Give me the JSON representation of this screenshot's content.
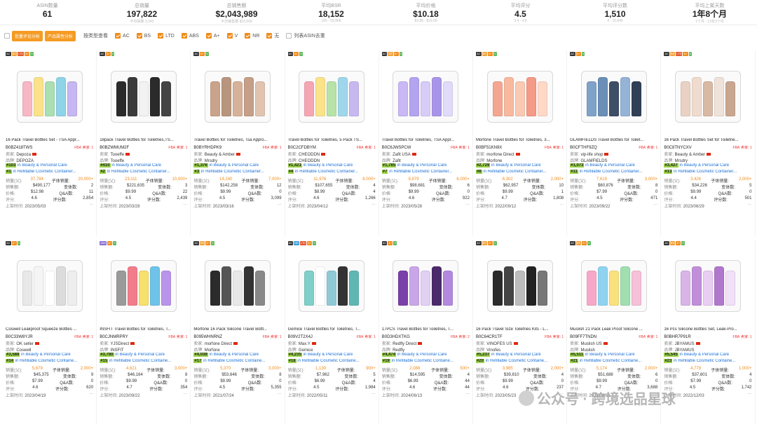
{
  "stats": [
    {
      "label": "ASIN数量",
      "value": "61",
      "sub": ""
    },
    {
      "label": "总销量",
      "value": "197,822",
      "sub": "平均销量 3,243"
    },
    {
      "label": "总销售额",
      "value": "$2,043,989",
      "sub": "平均销售额 $33,508"
    },
    {
      "label": "平均BSR",
      "value": "18,152",
      "sub": "105 - 59,868"
    },
    {
      "label": "平均价格",
      "value": "$10.18",
      "sub": "$3.88 - $19.99"
    },
    {
      "label": "平均评分",
      "value": "4.5",
      "sub": "3.4 - 4.8"
    },
    {
      "label": "平均评分数",
      "value": "1,510",
      "sub": "4 - 15,846"
    },
    {
      "label": "平均上架天数",
      "value": "1年8个月",
      "sub": "1个月 - 13年3个月"
    }
  ],
  "filters": {
    "btn1": "批量评论分析",
    "btn2": "产品属性分析",
    "group": "按类型查看",
    "opts": [
      "AC",
      "BS",
      "LTD",
      "ABS",
      "A+",
      "V",
      "NR",
      "无"
    ],
    "last": "列表ASIN去重"
  },
  "labels": {
    "seller": "卖家:",
    "brand": "品牌:",
    "sales": "销量(父):",
    "subsales": "子体销量:",
    "revenue": "销售额:",
    "variants": "变体数:",
    "price": "价格:",
    "qa": "Q&A数:",
    "rating": "评分:",
    "reviews": "评分数:",
    "date": "上架时间:",
    "fba": "FBA",
    "sellers": "卖家: ",
    "in": "in"
  },
  "cards": [
    {
      "badges": [
        "AC",
        "BS",
        "LTD",
        "A+",
        "V"
      ],
      "title": "16 Pack Travel Bottles Set - TSA Appr...",
      "asin": "B0BZ418TWS",
      "sellers": "1",
      "seller": "Depoza",
      "brand": "DEPOZA",
      "r1": "#103",
      "c1": "Beauty & Personal Care",
      "r2": "#1",
      "c2": "Refillable Cosmetic Container...",
      "sales": "37,784",
      "subsales": "20,000+",
      "revenue": "$490,177",
      "variants": "2",
      "price": "$12.98",
      "qa": "11",
      "rating": "4.6",
      "reviews": "2,854",
      "date": "2023/05/03"
    },
    {
      "badges": [
        "AC",
        "A+",
        "V"
      ],
      "title": "18pack Travel Bottles for Toiletries,TS...",
      "asin": "B0BZWMUM2F",
      "sellers": "1",
      "seller": "Tooeffe",
      "brand": "Tooeffe",
      "r1": "#410",
      "c1": "Beauty & Personal Care",
      "r2": "#2",
      "c2": "Refillable Cosmetic Container...",
      "sales": "23,111",
      "subsales": "10,000+",
      "revenue": "$221,635",
      "variants": "3",
      "price": "$9.99",
      "qa": "22",
      "rating": "4.5",
      "reviews": "2,439",
      "date": "2023/03/28"
    },
    {
      "badges": [
        "AC",
        "A+",
        "V"
      ],
      "title": "Travel Bottles for Toiletries, Tsa Appro...",
      "asin": "B0BYRHDPK9",
      "sellers": "1",
      "seller": "Beauty & Amber",
      "brand": "Mrsdry",
      "r1": "#1,376",
      "c1": "Beauty & Personal Care",
      "r2": "#3",
      "c2": "Refillable Cosmetic Container...",
      "sales": "14,240",
      "subsales": "7,000+",
      "revenue": "$142,258",
      "variants": "12",
      "price": "$9.99",
      "qa": "0",
      "rating": "4.5",
      "reviews": "3,099",
      "date": "2023/03/16"
    },
    {
      "badges": [
        "AC",
        "A+",
        "V"
      ],
      "title": "Travel Bottles for Toiletries, 5 Pack TS...",
      "asin": "B0C2CFDBYM",
      "sellers": "1",
      "seller": "CHEODDN",
      "brand": "CHEODDN",
      "r1": "#1,421",
      "c1": "Beauty & Personal Care",
      "r2": "#4",
      "c2": "Refillable Cosmetic Container...",
      "sales": "11,976",
      "subsales": "8,000+",
      "revenue": "$107,655",
      "variants": "4",
      "price": "$8.99",
      "qa": "4",
      "rating": "4.6",
      "reviews": "1,266",
      "date": "2023/04/12"
    },
    {
      "badges": [
        "AC",
        "BS",
        "A+",
        "V"
      ],
      "title": "Travel Bottles for Toiletries, TSA Appr...",
      "asin": "B0C6JWSPCW",
      "sellers": "1",
      "seller": "Zafit USA",
      "brand": "Zafit",
      "r1": "#1,785",
      "c1": "Beauty & Personal Care",
      "r2": "#7",
      "c2": "Refillable Cosmetic Container...",
      "sales": "9,879",
      "subsales": "6,000+",
      "revenue": "$98,681",
      "variants": "6",
      "price": "$9.99",
      "qa": "0",
      "rating": "4.6",
      "reviews": "922",
      "date": "2023/05/28"
    },
    {
      "badges": [
        "AC",
        "BS",
        "A+",
        "V"
      ],
      "title": "Morfone Travel Bottles for Toiletries, 3...",
      "asin": "B0BF51KN9X",
      "sellers": "1",
      "seller": "morfone Direct",
      "brand": "Morfone",
      "r1": "#2,729",
      "c1": "Beauty & Personal Care",
      "r2": "#8",
      "c2": "Refillable Cosmetic Container...",
      "sales": "6,302",
      "subsales": "2,000+",
      "revenue": "$62,957",
      "variants": "10",
      "price": "$9.99",
      "qa": "1",
      "rating": "4.7",
      "reviews": "1,808",
      "date": "2022/09/12"
    },
    {
      "badges": [
        "AC",
        "A+",
        "V"
      ],
      "title": "GLAMFIELDS Travel Bottles for Toilet...",
      "asin": "B0CFTHF9ZQ",
      "sellers": "1",
      "seller": "vip-life shop",
      "brand": "GLAMFIELDS",
      "r1": "#1,073",
      "c1": "Beauty & Personal Care",
      "r2": "#11",
      "c2": "Refillable Cosmetic Container...",
      "sales": "7,619",
      "subsales": "3,000+",
      "revenue": "$60,876",
      "variants": "8",
      "price": "$7.99",
      "qa": "0",
      "rating": "4.5",
      "reviews": "471",
      "date": "2023/09/22"
    },
    {
      "badges": [
        "AC",
        "BS",
        "LTD",
        "A+",
        "V"
      ],
      "title": "16 Pack Travel Bottles Set for Toiletrie...",
      "asin": "B0C8TNYCXV",
      "sellers": "1",
      "seller": "Beauty & Amber",
      "brand": "Mrsdry",
      "r1": "#3,427",
      "c1": "Beauty & Personal Care",
      "r2": "#13",
      "c2": "Refillable Cosmetic Container...",
      "sales": "3,426",
      "subsales": "2,000+",
      "revenue": "$34,226",
      "variants": "5",
      "price": "$9.99",
      "qa": "0",
      "rating": "4.4",
      "reviews": "501",
      "date": "2023/06/29"
    },
    {
      "badges": [
        "AC",
        "A+",
        "V"
      ],
      "title": "Coswell Leakproof Squeeze Bottles ...",
      "asin": "B0C33W8YJR",
      "sellers": "1",
      "seller": "OK seller",
      "brand": "Coswell",
      "r1": "#3,588",
      "c1": "Beauty & Personal Care",
      "r2": "#14",
      "c2": "Refillable Cosmetic Containe...",
      "sales": "5,679",
      "subsales": "2,000+",
      "revenue": "$45,375",
      "variants": "9",
      "price": "$7.99",
      "qa": "0",
      "rating": "4.6",
      "reviews": "620",
      "date": "2023/04/19"
    },
    {
      "badges": [
        "ABS",
        "A+",
        "V"
      ],
      "title": "INSFIT Travel Bottles for Toiletries, T...",
      "asin": "B0CJNMRPRY",
      "sellers": "1",
      "seller": "YJSDirect",
      "brand": "INSFIT",
      "r1": "#3,780",
      "c1": "Beauty & Personal Care",
      "r2": "#15",
      "c2": "Refillable Cosmetic Containe...",
      "sales": "4,621",
      "subsales": "3,000+",
      "revenue": "$46,164",
      "variants": "8",
      "price": "$9.99",
      "qa": "0",
      "rating": "4.7",
      "reviews": "354",
      "date": "2023/09/22"
    },
    {
      "badges": [
        "AC",
        "BS",
        "A+",
        "V"
      ],
      "title": "Morfone 16 Pack Silicone Travel Bottl...",
      "asin": "B095WHNRNZ",
      "sellers": "1",
      "seller": "morfone Direct",
      "brand": "Morfone",
      "r1": "#4,038",
      "c1": "Beauty & Personal Care",
      "r2": "#17",
      "c2": "Refillable Cosmetic Containe...",
      "sales": "5,370",
      "subsales": "3,000+",
      "revenue": "$53,646",
      "variants": "8",
      "price": "$9.99",
      "qa": "0",
      "rating": "4.5",
      "reviews": "5,355",
      "date": "2021/07/24"
    },
    {
      "badges": [
        "AC",
        "NR",
        "LTD",
        "A+",
        "V"
      ],
      "title": "Gemice Travel Bottles for Toiletries, T...",
      "asin": "B09V2T2X4J",
      "sellers": "1",
      "seller": "Max.Y",
      "brand": "Gemice",
      "r1": "#4,235",
      "c1": "Beauty & Personal Care",
      "r2": "#18",
      "c2": "Refillable Cosmetic Containe...",
      "sales": "1,139",
      "subsales": "900+",
      "revenue": "$7,962",
      "variants": "5",
      "price": "$6.99",
      "qa": "4",
      "rating": "4.5",
      "reviews": "1,984",
      "date": "2022/05/11"
    },
    {
      "badges": [
        "AC",
        "A+",
        "V"
      ],
      "title": "17PCS Travel Bottles for Toiletries, T...",
      "asin": "B0D3HDXTKG",
      "sellers": "2",
      "seller": "Redfly Direct",
      "brand": "Redfly",
      "r1": "#4,474",
      "c1": "Beauty & Personal Care",
      "r2": "#19",
      "c2": "Refillable Cosmetic Containe...",
      "sales": "2,088",
      "subsales": "500+",
      "revenue": "$14,595",
      "variants": "4",
      "price": "$6.99",
      "qa": "44",
      "rating": "4.6",
      "reviews": "44",
      "date": "2024/06/13"
    },
    {
      "badges": [
        "AC",
        "BS",
        "A+",
        "V"
      ],
      "title": "16 Pack Travel Size Toiletries Kits - L...",
      "asin": "B0C64CR1TF",
      "sellers": "1",
      "seller": "VINOFES US",
      "brand": "Vinofes",
      "r1": "#5,237",
      "c1": "Beauty & Personal Care",
      "r2": "#20",
      "c2": "Refillable Cosmetic Containe...",
      "sales": "3,985",
      "subsales": "2,000+",
      "revenue": "$39,810",
      "variants": "4",
      "price": "$9.99",
      "qa": "0",
      "rating": "4.6",
      "reviews": "237",
      "date": "2023/05/23"
    },
    {
      "badges": [
        "AC",
        "BS",
        "A+",
        "V"
      ],
      "title": "Muslish 21 Pack Leak Proof Silicone ...",
      "asin": "B09FF7TNDN",
      "sellers": "1",
      "seller": "Muslish US",
      "brand": "Muslish",
      "r1": "#5,511",
      "c1": "Beauty & Personal Care",
      "r2": "#21",
      "c2": "Refillable Cosmetic Containe...",
      "sales": "5,174",
      "subsales": "2,000+",
      "revenue": "$51,688",
      "variants": "6",
      "price": "$9.99",
      "qa": "0",
      "rating": "4.7",
      "reviews": "3,688",
      "date": "2021/09/02"
    },
    {
      "badges": [
        "AC",
        "BS",
        "A+",
        "V"
      ],
      "title": "16 Pcs Silicone Bottles Set, Leak-Pro...",
      "asin": "B0BHR7P91R",
      "sellers": "1",
      "seller": "JBYAMUS",
      "brand": "JBYAMUS",
      "r1": "#5,545",
      "c1": "Beauty & Personal Care",
      "r2": "#23",
      "c2": "Refillable Cosmetic Containe...",
      "sales": "4,778",
      "subsales": "1,000+",
      "revenue": "$37,601",
      "variants": "4",
      "price": "$7.99",
      "qa": "0",
      "rating": "4.5",
      "reviews": "1,742",
      "date": "2022/12/03"
    }
  ],
  "watermark": "公众号 · 跨境选品星球",
  "colors": {
    "accent": "#f59b23",
    "link": "#1a6fd6",
    "rank_bg": "#9bd34b",
    "fba": "#e33333"
  }
}
